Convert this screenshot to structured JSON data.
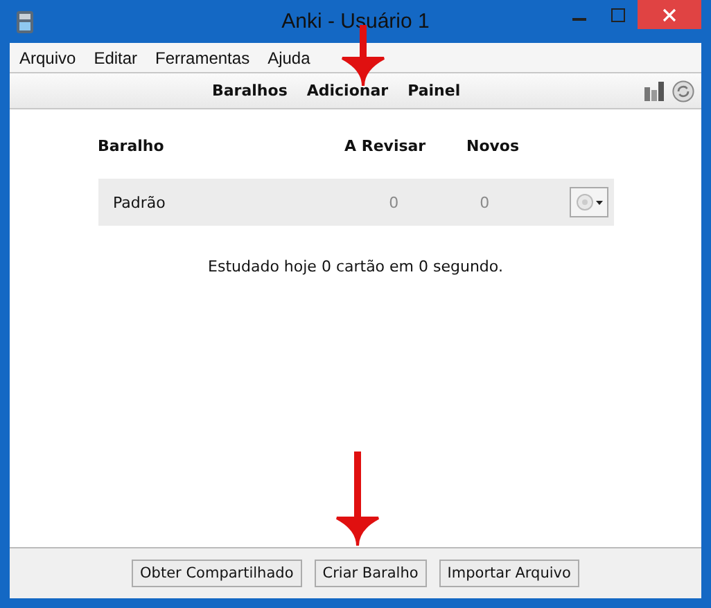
{
  "window": {
    "title": "Anki - Usuário 1"
  },
  "menu": [
    "Arquivo",
    "Editar",
    "Ferramentas",
    "Ajuda"
  ],
  "toolbar": [
    "Baralhos",
    "Adicionar",
    "Painel"
  ],
  "decks": {
    "columns": [
      "Baralho",
      "A Revisar",
      "Novos"
    ],
    "rows": [
      {
        "name": "Padrão",
        "due": "0",
        "new": "0"
      }
    ]
  },
  "status": "Estudado hoje 0 cartão em 0 segundo.",
  "buttons": [
    "Obter Compartilhado",
    "Criar Baralho",
    "Importar Arquivo"
  ]
}
